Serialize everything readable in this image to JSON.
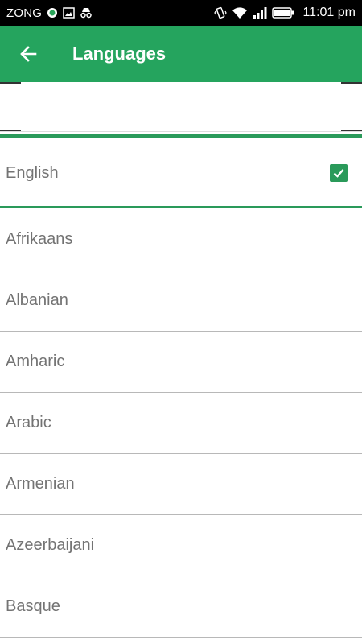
{
  "status_bar": {
    "carrier": "ZONG",
    "time": "11:01 pm",
    "icons": [
      "whatsapp-icon",
      "gallery-icon",
      "incognito-icon",
      "vibrate-icon",
      "wifi-icon",
      "signal-icon",
      "battery-icon"
    ]
  },
  "app_bar": {
    "title": "Languages",
    "back_icon": "arrow-back-icon",
    "color": "#25a45e"
  },
  "search": {
    "value": "",
    "placeholder": ""
  },
  "selected_language": {
    "label": "English",
    "checked": true,
    "check_icon": "checkbox-checked-icon",
    "accent_color": "#2a9a5a"
  },
  "languages": [
    {
      "label": "Afrikaans"
    },
    {
      "label": "Albanian"
    },
    {
      "label": "Amharic"
    },
    {
      "label": "Arabic"
    },
    {
      "label": "Armenian"
    },
    {
      "label": "Azeerbaijani"
    },
    {
      "label": "Basque"
    }
  ]
}
